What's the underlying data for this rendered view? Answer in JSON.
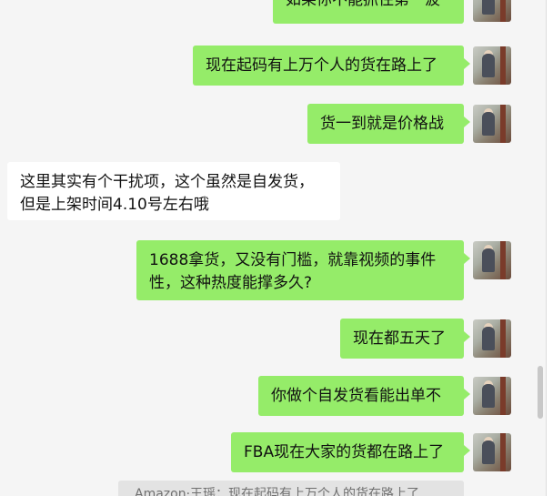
{
  "messages": [
    {
      "side": "sent",
      "text": "如果你不能抓住第一波"
    },
    {
      "side": "sent",
      "text": "现在起码有上万个人的货在路上了"
    },
    {
      "side": "sent",
      "text": "货一到就是价格战"
    },
    {
      "side": "recv",
      "text": "这里其实有个干扰项，这个虽然是自发货，但是上架时间4.10号左右哦"
    },
    {
      "side": "sent",
      "text": "1688拿货，又没有门槛，就靠视频的事件性，这种热度能撑多久?"
    },
    {
      "side": "sent",
      "text": "现在都五天了"
    },
    {
      "side": "sent",
      "text": "你做个自发货看能出单不"
    },
    {
      "side": "sent",
      "text": "FBA现在大家的货都在路上了"
    }
  ],
  "quote_text": "Amazon·王瑶：现在起码有上万个人的货在路上了",
  "colors": {
    "sent": "#95ec69",
    "recv": "#ffffff",
    "background": "#f5f5f5"
  }
}
